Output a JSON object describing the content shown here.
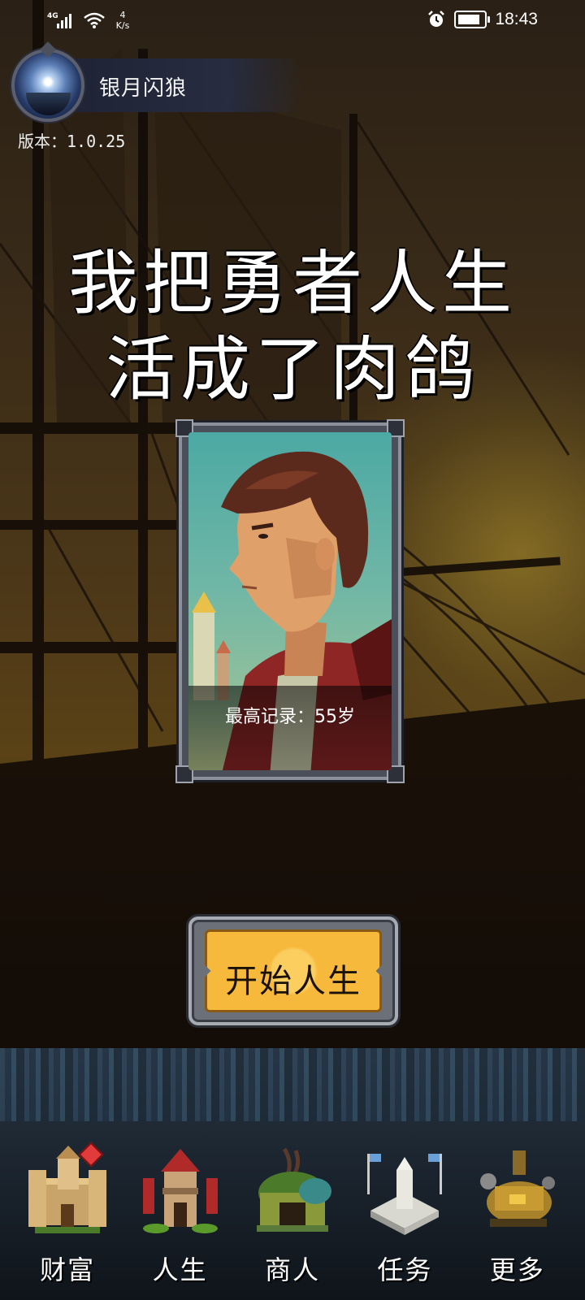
{
  "statusbar": {
    "network": "4G",
    "speed_value": "4",
    "speed_unit": "K/s",
    "time": "18:43",
    "icons": [
      "signal-icon",
      "wifi-icon",
      "alarm-icon",
      "battery-charging-icon"
    ]
  },
  "profile": {
    "username": "银月闪狼",
    "version": "版本：1.0.25"
  },
  "title": {
    "line1": "我把勇者人生",
    "line2": "活成了肉鸽"
  },
  "hero_card": {
    "record": "最高记录：55岁"
  },
  "start_button": {
    "label": "开始人生"
  },
  "nav": {
    "items": [
      {
        "label": "财富",
        "icon": "castle-icon",
        "badge": true
      },
      {
        "label": "人生",
        "icon": "tower-icon",
        "badge": false
      },
      {
        "label": "商人",
        "icon": "merchant-hut-icon",
        "badge": false
      },
      {
        "label": "任务",
        "icon": "monument-icon",
        "badge": false
      },
      {
        "label": "更多",
        "icon": "workshop-icon",
        "badge": false
      }
    ]
  },
  "colors": {
    "accent": "#f7b93c",
    "badge": "#e23b3b",
    "frame": "#8b909c"
  }
}
